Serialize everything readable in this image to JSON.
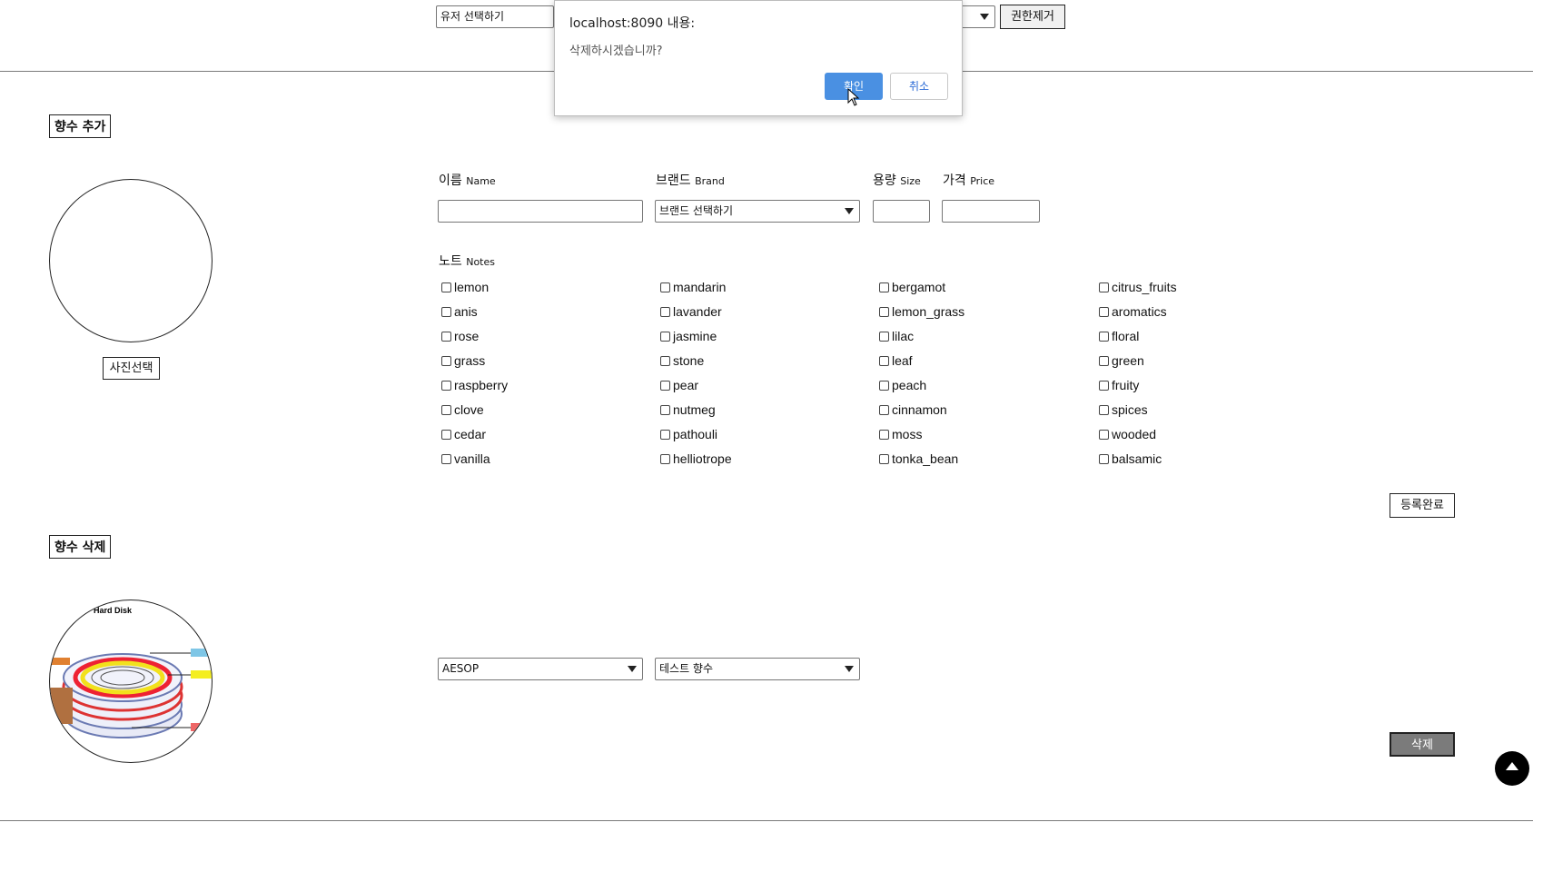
{
  "top": {
    "user_select": "유저 선택하기",
    "remove_permission_label": "권한제거"
  },
  "add_section": {
    "title": "향수 추가",
    "photo_button": "사진선택",
    "labels": {
      "name_ko": "이름",
      "name_en": "Name",
      "brand_ko": "브랜드",
      "brand_en": "Brand",
      "size_ko": "용량",
      "size_en": "Size",
      "price_ko": "가격",
      "price_en": "Price",
      "notes_ko": "노트",
      "notes_en": "Notes"
    },
    "brand_select": "브랜드 선택하기",
    "notes": [
      [
        "lemon",
        "mandarin",
        "bergamot",
        "citrus_fruits"
      ],
      [
        "anis",
        "lavander",
        "lemon_grass",
        "aromatics"
      ],
      [
        "rose",
        "jasmine",
        "lilac",
        "floral"
      ],
      [
        "grass",
        "stone",
        "leaf",
        "green"
      ],
      [
        "raspberry",
        "pear",
        "peach",
        "fruity"
      ],
      [
        "clove",
        "nutmeg",
        "cinnamon",
        "spices"
      ],
      [
        "cedar",
        "pathouli",
        "moss",
        "wooded"
      ],
      [
        "vanilla",
        "helliotrope",
        "tonka_bean",
        "balsamic"
      ]
    ],
    "submit_label": "등록완료"
  },
  "delete_section": {
    "title": "향수 삭제",
    "image_caption": "Hard Disk",
    "brand_select": "AESOP",
    "perfume_select": "테스트 향수",
    "delete_label": "삭제"
  },
  "dialog": {
    "title": "localhost:8090 내용:",
    "message": "삭제하시겠습니까?",
    "ok_label": "확인",
    "cancel_label": "취소"
  },
  "colors": {
    "dialog_ok_bg": "#4a90e2",
    "delete_button_bg": "#7b7b7b",
    "scroll_top_bg": "#000000"
  },
  "icons": {
    "scroll_top": "triangle-up-icon",
    "cursor": "mouse-pointer-icon",
    "select_arrow": "chevron-down-icon"
  }
}
